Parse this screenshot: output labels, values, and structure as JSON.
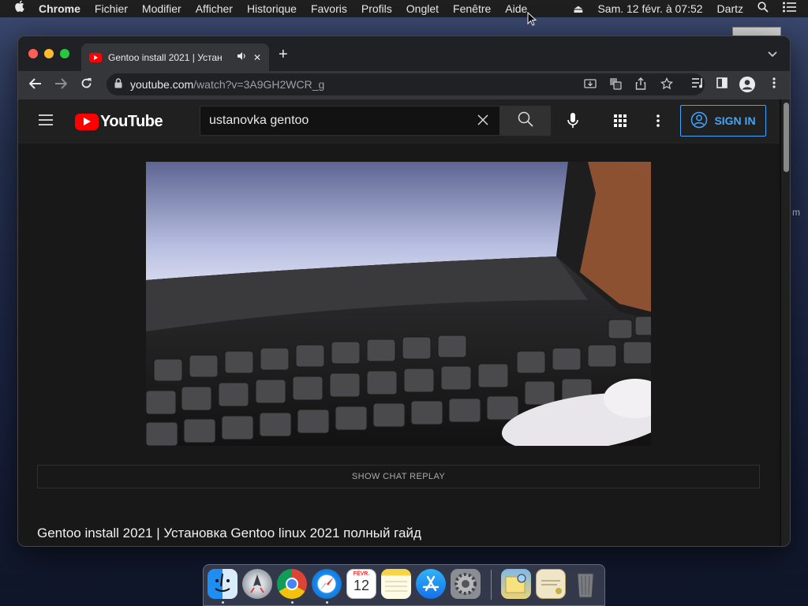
{
  "menubar": {
    "apple": "",
    "app": "Chrome",
    "items": [
      "Fichier",
      "Modifier",
      "Afficher",
      "Historique",
      "Favoris",
      "Profils",
      "Onglet",
      "Fenêtre",
      "Aide"
    ],
    "eject": "⏏",
    "datetime": "Sam. 12 févr. à  07:52",
    "user": "Dartz"
  },
  "desktop": {
    "side_text": "m"
  },
  "browser": {
    "tab": {
      "title": "Gentoo install 2021 | Устан",
      "audio_icon": "speaker-icon",
      "close": "✕"
    },
    "new_tab": "+",
    "url": {
      "host": "youtube.com",
      "path": "/watch?v=3A9GH2WCR_g"
    }
  },
  "youtube": {
    "logo": "YouTube",
    "search": {
      "value": "ustanovka gentoo"
    },
    "sign_in": "SIGN IN",
    "show_chat_replay": "SHOW CHAT REPLAY",
    "video_title": "Gentoo install 2021 | Установка Gentoo linux 2021 полный гайд"
  },
  "dock": {
    "apps": [
      "finder-icon",
      "launchpad-icon",
      "chrome-icon",
      "safari-icon",
      "calendar-icon",
      "notes-icon",
      "app-store-icon",
      "system-preferences-icon",
      "preview-icon",
      "certificate-icon",
      "trash-icon"
    ],
    "calendar": {
      "month": "FÉVR.",
      "day": "12"
    }
  },
  "colors": {
    "youtube_red": "#ff0000",
    "link_blue": "#3ea6ff",
    "menubar": "#1f1f20"
  }
}
